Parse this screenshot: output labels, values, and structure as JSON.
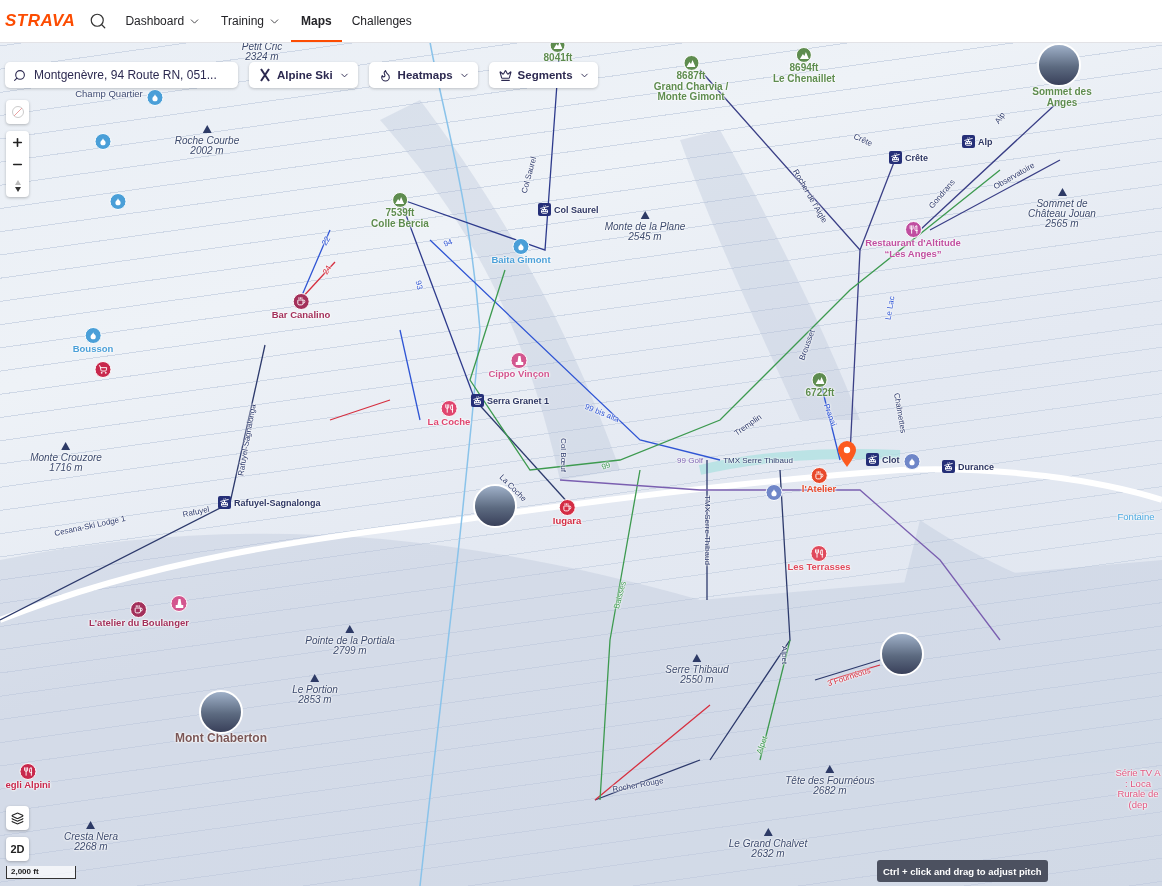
{
  "nav": {
    "logo": "STRAVA",
    "items": [
      {
        "label": "Dashboard",
        "dropdown": true,
        "selected": false
      },
      {
        "label": "Training",
        "dropdown": true,
        "selected": false
      },
      {
        "label": "Maps",
        "dropdown": false,
        "selected": true
      },
      {
        "label": "Challenges",
        "dropdown": false,
        "selected": false
      }
    ]
  },
  "search": {
    "value": "Montgenèvre, 94 Route RN, 051..."
  },
  "filters": [
    {
      "label": "Alpine Ski",
      "kind": "ski"
    },
    {
      "label": "Heatmaps",
      "kind": "heatmap"
    },
    {
      "label": "Segments",
      "kind": "segments"
    }
  ],
  "map": {
    "peaks": [
      {
        "name": "Petit Cric",
        "elevation": "2324 m"
      },
      {
        "name": "Roche Courbe",
        "elevation": "2002 m"
      },
      {
        "name": "Monte de la Plane",
        "elevation": "2545 m"
      },
      {
        "name": "Sommet de Château Jouan",
        "elevation": "2565 m"
      },
      {
        "name": "Monte Crouzore",
        "elevation": "1716 m"
      },
      {
        "name": "Pointe de la Portiala",
        "elevation": "2799 m"
      },
      {
        "name": "Le Portion",
        "elevation": "2853 m"
      },
      {
        "name": "Serre Thibaud",
        "elevation": "2550 m"
      },
      {
        "name": "Tête des Fournéous",
        "elevation": "2682 m"
      },
      {
        "name": "Le Grand Chalvet",
        "elevation": "2632 m"
      },
      {
        "name": "Cresta Nera",
        "elevation": "2268 m"
      }
    ],
    "summits": [
      {
        "kind": "summit",
        "height": "8041ft"
      },
      {
        "kind": "summit",
        "height": "8687ft",
        "name": "Grand Charvia / Monte Gimont"
      },
      {
        "kind": "summit",
        "height": "8694ft",
        "name": "Le Chenaillet"
      },
      {
        "kind": "summit",
        "height": "7539ft",
        "name": "Colle Bercia"
      },
      {
        "kind": "summit",
        "height": "6722ft"
      },
      {
        "kind": "summit",
        "name": "Sommet des Anges"
      },
      {
        "kind": "landmark",
        "name": "Mont Chaberton"
      }
    ],
    "pois": [
      {
        "kind": "place",
        "name": "Champ Quartier"
      },
      {
        "kind": "water",
        "color": "#4a9fd8"
      },
      {
        "kind": "water",
        "color": "#4a9fd8"
      },
      {
        "kind": "water",
        "color": "#4a9fd8"
      },
      {
        "kind": "water",
        "name": "Baita Gimont",
        "color": "#4a9fd8"
      },
      {
        "kind": "restaurant",
        "name": "Restaurant d'Altitude “Les Anges”",
        "color": "#c04ea0"
      },
      {
        "kind": "cafe",
        "name": "Bar Canalino",
        "color": "#a3305a"
      },
      {
        "kind": "water",
        "name": "Bousson",
        "color": "#4a9fd8"
      },
      {
        "kind": "shop",
        "color": "#c8284c"
      },
      {
        "kind": "monument",
        "name": "Cippo Vinçon",
        "color": "#d3568f"
      },
      {
        "kind": "restaurant",
        "name": "La Coche",
        "color": "#e0456f"
      },
      {
        "kind": "cafe",
        "name": "Iugara",
        "color": "#d42c44"
      },
      {
        "kind": "water",
        "color": "#6f86c8"
      },
      {
        "kind": "cafe",
        "name": "l'Atelier",
        "color": "#e84a2c"
      },
      {
        "kind": "water",
        "color": "#6f86c8"
      },
      {
        "kind": "water",
        "name": "Fontaine"
      },
      {
        "kind": "restaurant",
        "name": "Les Terrasses",
        "color": "#e04a5c"
      },
      {
        "kind": "cafe",
        "name": "L'atelier du Boulanger",
        "color": "#a3305a"
      },
      {
        "kind": "monument",
        "color": "#d3568f"
      },
      {
        "kind": "restaurant",
        "name": "egli Alpini",
        "color": "#c8284c"
      },
      {
        "kind": "attraction",
        "name": "Série TV A : Loca Rurale de (dep"
      }
    ],
    "lifts": [
      {
        "name": "Col Saurel"
      },
      {
        "name": "Crête"
      },
      {
        "name": "Alp"
      },
      {
        "name": "Serra Granet 1"
      },
      {
        "name": "Rafuyel-Sagnalonga"
      },
      {
        "name": "Clot"
      },
      {
        "name": "Durance"
      }
    ],
    "trails": [
      {
        "name": "Col Saurel",
        "kind": "lift"
      },
      {
        "name": "22",
        "kind": "blue"
      },
      {
        "name": "24",
        "kind": "red"
      },
      {
        "name": "94",
        "kind": "blue"
      },
      {
        "name": "93",
        "kind": "blue"
      },
      {
        "name": "Rocher de l'Aigle",
        "kind": "lift"
      },
      {
        "name": "Crête",
        "kind": "lift"
      },
      {
        "name": "Alp",
        "kind": "lift"
      },
      {
        "name": "Gondrans",
        "kind": "lift"
      },
      {
        "name": "Observatoire",
        "kind": "lift"
      },
      {
        "name": "Le Lac",
        "kind": "blue"
      },
      {
        "name": "Brousset",
        "kind": "lift"
      },
      {
        "name": "Tremplin",
        "kind": "lift"
      },
      {
        "name": "Pranai",
        "kind": "blue"
      },
      {
        "name": "Chalmettes",
        "kind": "lift"
      },
      {
        "name": "99 bis alta",
        "kind": "blue"
      },
      {
        "name": "99",
        "kind": "green"
      },
      {
        "name": "99 Golf",
        "kind": "route"
      },
      {
        "name": "TMX Serre Thibaud",
        "kind": "lift"
      },
      {
        "name": "TMX Serre Thibaud",
        "kind": "lift"
      },
      {
        "name": "Col Bœuf",
        "kind": "lift"
      },
      {
        "name": "La Coche",
        "kind": "lift"
      },
      {
        "name": "Rafuyel-Sagnalonga",
        "kind": "lift"
      },
      {
        "name": "Rafuyel",
        "kind": "lift"
      },
      {
        "name": "Cesana-Ski Lodge 1",
        "kind": "lift"
      },
      {
        "name": "Baisses",
        "kind": "green"
      },
      {
        "name": "Alpet",
        "kind": "lift"
      },
      {
        "name": "Alpet",
        "kind": "green"
      },
      {
        "name": "3 Fournéous",
        "kind": "red"
      },
      {
        "name": "Rocher Rouge",
        "kind": "lift"
      }
    ],
    "scale": "2,000 ft",
    "view_mode": "2D",
    "hint": "Ctrl + click and drag to adjust pitch"
  }
}
